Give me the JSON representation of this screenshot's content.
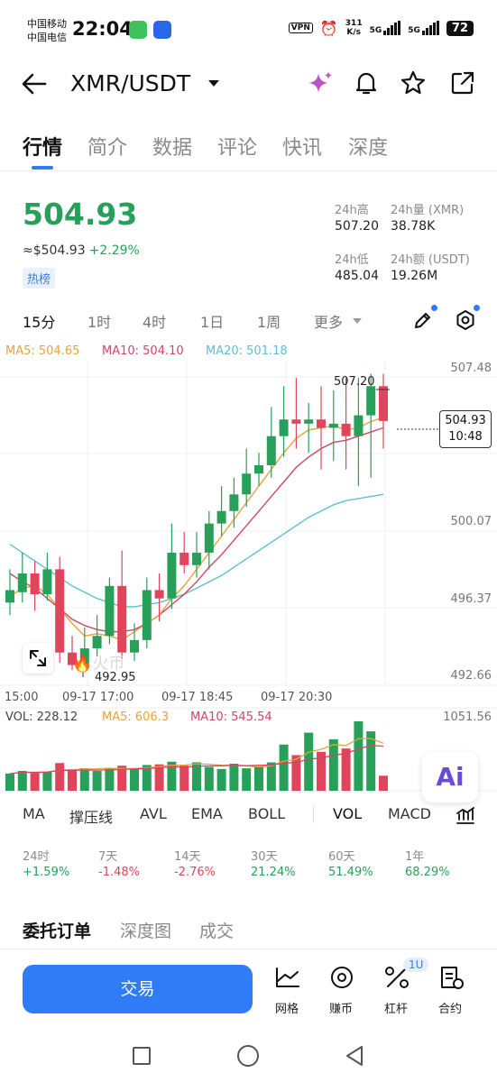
{
  "status_bar": {
    "carrier1": "中国移动",
    "carrier2": "中国电信",
    "time": "22:04",
    "vpn": "VPN",
    "speed_top": "311",
    "speed_unit": "K/s",
    "net1": "5G",
    "net2": "5G",
    "battery": "72"
  },
  "header": {
    "pair": "XMR/USDT",
    "icons": [
      "back-arrow-icon",
      "sparkle-icon",
      "bell-icon",
      "star-icon",
      "share-icon"
    ]
  },
  "tabs": [
    "行情",
    "简介",
    "数据",
    "评论",
    "快讯",
    "深度"
  ],
  "price_block": {
    "price": "504.93",
    "approx": "≈$504.93",
    "change": "+2.29%",
    "tag": "热榜",
    "stats": [
      {
        "label": "24h高",
        "value": "507.20"
      },
      {
        "label": "24h量 (XMR)",
        "value": "38.78K"
      },
      {
        "label": "24h低",
        "value": "485.04"
      },
      {
        "label": "24h额 (USDT)",
        "value": "19.26M"
      }
    ]
  },
  "intervals": [
    "15分",
    "1时",
    "4时",
    "1日",
    "1周",
    "更多"
  ],
  "ma_legend": {
    "ma5": "MA5: 504.65",
    "ma10": "MA10: 504.10",
    "ma20": "MA20: 501.18"
  },
  "price_axis": [
    "507.48",
    "500.07",
    "496.37",
    "492.66"
  ],
  "time_axis": [
    "15:00",
    "09-17 17:00",
    "09-17 18:45",
    "09-17 20:30"
  ],
  "high_label": "507.20",
  "low_label": "492.95",
  "current_box": {
    "price": "504.93",
    "countdown": "10:48"
  },
  "watermark": "火币",
  "vol_legend": {
    "vol": "VOL: 228.12",
    "ma5": "MA5: 606.3",
    "ma10": "MA10: 545.54",
    "max": "1051.56"
  },
  "ai_button": "Ai",
  "indicators": [
    "MA",
    "撑压线",
    "AVL",
    "EMA",
    "BOLL",
    "VOL",
    "MACD"
  ],
  "performance": [
    {
      "label": "24时",
      "value": "+1.59%"
    },
    {
      "label": "7天",
      "value": "-1.48%"
    },
    {
      "label": "14天",
      "value": "-2.76%"
    },
    {
      "label": "30天",
      "value": "21.24%"
    },
    {
      "label": "60天",
      "value": "51.49%"
    },
    {
      "label": "1年",
      "value": "68.29%"
    }
  ],
  "order_tabs": [
    "委托订单",
    "深度图",
    "成交"
  ],
  "bottom_bar": {
    "trade": "交易",
    "grid": "网格",
    "earn": "赚币",
    "leverage": "杠杆",
    "leverage_badge": "1U",
    "contract": "合约"
  },
  "colors": {
    "up": "#28a05a",
    "down": "#e0455c",
    "accent": "#2f7cf6",
    "ma5": "#e8a23a",
    "ma10": "#d0456a",
    "ma20": "#5bbfd6"
  },
  "chart_data": {
    "type": "candlestick",
    "y_axis_labels": [
      507.48,
      500.07,
      496.37,
      492.66
    ],
    "high": 507.2,
    "low": 492.95,
    "last": 504.93,
    "candles": [
      {
        "o": 496.2,
        "c": 496.8,
        "h": 497.8,
        "l": 495.6
      },
      {
        "o": 496.7,
        "c": 497.6,
        "h": 498.6,
        "l": 496.2
      },
      {
        "o": 497.6,
        "c": 496.6,
        "h": 498.2,
        "l": 495.8
      },
      {
        "o": 496.6,
        "c": 497.8,
        "h": 498.6,
        "l": 496.3
      },
      {
        "o": 497.8,
        "c": 493.8,
        "h": 498.4,
        "l": 493.3
      },
      {
        "o": 493.8,
        "c": 493.2,
        "h": 494.6,
        "l": 492.95
      },
      {
        "o": 493.2,
        "c": 494.0,
        "h": 495.0,
        "l": 493.0
      },
      {
        "o": 494.0,
        "c": 494.6,
        "h": 495.6,
        "l": 493.6
      },
      {
        "o": 494.6,
        "c": 497.0,
        "h": 497.4,
        "l": 494.2
      },
      {
        "o": 497.0,
        "c": 493.8,
        "h": 498.7,
        "l": 493.5
      },
      {
        "o": 493.8,
        "c": 494.4,
        "h": 495.2,
        "l": 493.4
      },
      {
        "o": 494.4,
        "c": 496.8,
        "h": 497.4,
        "l": 494.0
      },
      {
        "o": 496.8,
        "c": 496.4,
        "h": 497.6,
        "l": 495.3
      },
      {
        "o": 496.4,
        "c": 498.6,
        "h": 500.0,
        "l": 495.9
      },
      {
        "o": 498.6,
        "c": 498.0,
        "h": 499.6,
        "l": 497.6
      },
      {
        "o": 498.0,
        "c": 498.6,
        "h": 499.6,
        "l": 497.4
      },
      {
        "o": 498.6,
        "c": 500.0,
        "h": 500.6,
        "l": 497.8
      },
      {
        "o": 500.0,
        "c": 500.6,
        "h": 501.8,
        "l": 499.4
      },
      {
        "o": 500.6,
        "c": 501.4,
        "h": 502.2,
        "l": 499.8
      },
      {
        "o": 501.4,
        "c": 502.4,
        "h": 503.6,
        "l": 500.8
      },
      {
        "o": 502.4,
        "c": 502.8,
        "h": 503.4,
        "l": 501.8
      },
      {
        "o": 502.8,
        "c": 504.2,
        "h": 505.6,
        "l": 502.2
      },
      {
        "o": 504.2,
        "c": 505.0,
        "h": 506.6,
        "l": 503.2
      },
      {
        "o": 505.0,
        "c": 504.8,
        "h": 507.0,
        "l": 503.6
      },
      {
        "o": 504.8,
        "c": 505.0,
        "h": 505.8,
        "l": 503.4
      },
      {
        "o": 505.0,
        "c": 504.6,
        "h": 506.6,
        "l": 502.6
      },
      {
        "o": 504.6,
        "c": 504.8,
        "h": 506.4,
        "l": 503.0
      },
      {
        "o": 504.8,
        "c": 504.2,
        "h": 507.0,
        "l": 502.6
      },
      {
        "o": 504.2,
        "c": 505.2,
        "h": 507.0,
        "l": 501.8
      },
      {
        "o": 505.2,
        "c": 506.6,
        "h": 507.2,
        "l": 502.2
      },
      {
        "o": 506.6,
        "c": 504.93,
        "h": 507.2,
        "l": 503.6
      }
    ],
    "ma5": [
      496.5,
      496.9,
      497.0,
      496.6,
      495.9,
      495.2,
      494.6,
      494.7,
      494.6,
      494.4,
      494.8,
      495.2,
      495.6,
      496.4,
      497.0,
      497.8,
      498.6,
      499.4,
      500.2,
      501.0,
      501.8,
      502.6,
      503.4,
      504.1,
      504.5,
      504.6,
      504.7,
      504.5,
      504.6,
      504.9,
      505.1
    ],
    "ma10": [
      497.6,
      497.2,
      496.9,
      496.4,
      495.9,
      495.4,
      495.1,
      494.9,
      494.8,
      494.8,
      494.9,
      495.2,
      495.6,
      496.1,
      496.6,
      497.2,
      497.9,
      498.5,
      499.2,
      499.9,
      500.6,
      501.3,
      502.0,
      502.7,
      503.2,
      503.6,
      503.9,
      504.0,
      504.2,
      504.4,
      504.6
    ],
    "ma20": [
      499.0,
      498.6,
      498.2,
      497.8,
      497.4,
      497.0,
      496.7,
      496.4,
      496.2,
      496.0,
      496.0,
      496.1,
      496.2,
      496.4,
      496.6,
      496.9,
      497.2,
      497.5,
      497.9,
      498.3,
      498.7,
      499.1,
      499.5,
      499.9,
      500.3,
      500.6,
      500.9,
      501.1,
      501.2,
      501.3,
      501.4
    ],
    "volumes": [
      260,
      300,
      280,
      290,
      420,
      310,
      340,
      300,
      340,
      380,
      330,
      390,
      400,
      440,
      380,
      430,
      360,
      330,
      410,
      340,
      370,
      430,
      700,
      540,
      880,
      590,
      780,
      640,
      1051.56,
      900,
      228.12
    ],
    "vol_max": 1051.56
  }
}
